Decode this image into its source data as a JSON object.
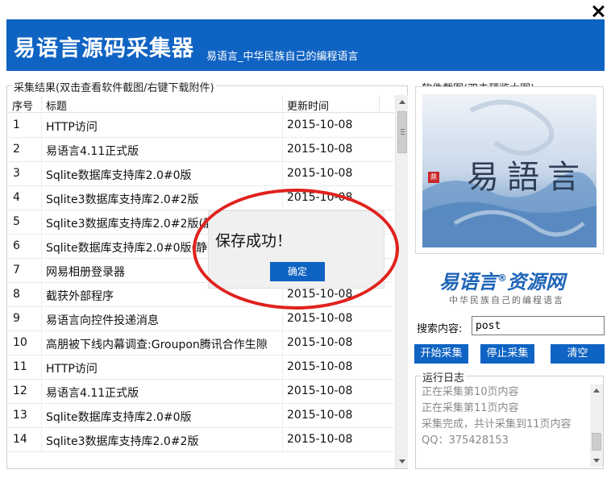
{
  "window": {
    "title": "易语言源码采集器",
    "subtitle": "易语言_中华民族自己的编程语言",
    "close_icon": "close-icon"
  },
  "results": {
    "group_label": "采集结果(双击查看软件截图/右键下载附件)",
    "columns": [
      "序号",
      "标题",
      "更新时间"
    ],
    "rows": [
      {
        "no": "1",
        "title": "HTTP访问",
        "date": "2015-10-08"
      },
      {
        "no": "2",
        "title": "易语言4.11正式版",
        "date": "2015-10-08"
      },
      {
        "no": "3",
        "title": "Sqlite数据库支持库2.0#0版",
        "date": "2015-10-08"
      },
      {
        "no": "4",
        "title": "Sqlite3数据库支持库2.0#2版",
        "date": "2015-10-08"
      },
      {
        "no": "5",
        "title": "Sqlite3数据库支持库2.0#2版(静态",
        "date": ""
      },
      {
        "no": "6",
        "title": "Sqlite数据库支持库2.0#0版(静态",
        "date": ""
      },
      {
        "no": "7",
        "title": "网易相册登录器",
        "date": ""
      },
      {
        "no": "8",
        "title": "截获外部程序",
        "date": "2015-10-08"
      },
      {
        "no": "9",
        "title": "易语言向控件投递消息",
        "date": "2015-10-08"
      },
      {
        "no": "10",
        "title": "高朋被下线内幕调查:Groupon腾讯合作生隙",
        "date": "2015-10-08"
      },
      {
        "no": "11",
        "title": "HTTP访问",
        "date": "2015-10-08"
      },
      {
        "no": "12",
        "title": "易语言4.11正式版",
        "date": "2015-10-08"
      },
      {
        "no": "13",
        "title": "Sqlite数据库支持库2.0#0版",
        "date": "2015-10-08"
      },
      {
        "no": "14",
        "title": "Sqlite3数据库支持库2.0#2版",
        "date": "2015-10-08"
      }
    ]
  },
  "preview": {
    "label": "软件截图(双击预览大图)",
    "image_chars": [
      "易",
      "語",
      "言"
    ]
  },
  "brand": {
    "name": "易语言",
    "mark": "®",
    "suffix": "资源网",
    "tagline": "中华民族自己的编程语言"
  },
  "search": {
    "label": "搜索内容:",
    "value": "post"
  },
  "buttons": {
    "start": "开始采集",
    "stop": "停止采集",
    "clear": "清空"
  },
  "log": {
    "label": "运行日志",
    "lines": [
      "正在采集第10页内容",
      "正在采集第11页内容",
      "采集完成，共计采集到11页内容",
      "QQ：375428153"
    ]
  },
  "dialog": {
    "message": "保存成功！",
    "ok_label": "确定"
  },
  "colors": {
    "accent": "#0f63c3",
    "highlight_ellipse": "#e0221e"
  }
}
